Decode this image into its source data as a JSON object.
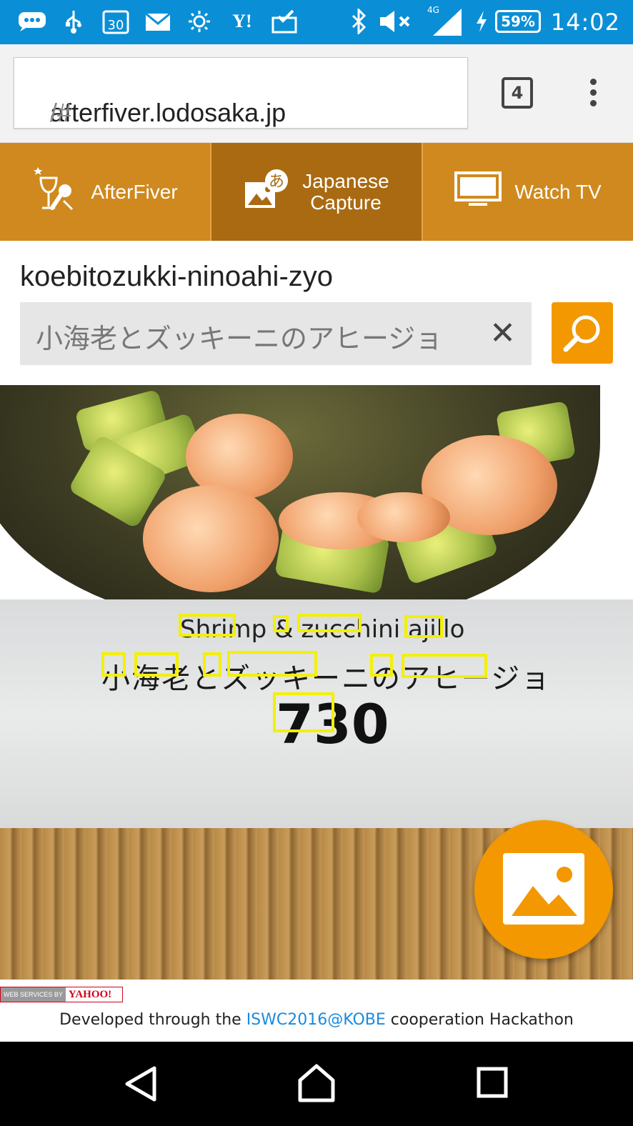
{
  "status_bar": {
    "time": "14:02",
    "battery_percent": "59%",
    "network_type": "4G",
    "date_icon_label": "30",
    "icons": [
      "chat-icon",
      "usb-icon",
      "calendar-icon",
      "mail-icon",
      "brightness-icon",
      "yahoo-icon",
      "mail-check-icon",
      "bluetooth-icon",
      "mute-icon",
      "signal-icon",
      "charging-icon"
    ]
  },
  "browser": {
    "url_host": "afterfiver.lodosaka.jp",
    "url_path": "/#",
    "tab_count": "4"
  },
  "nav": {
    "items": [
      {
        "label": "AfterFiver",
        "icon": "wine-mic-icon"
      },
      {
        "label_line1": "Japanese",
        "label_line2": "Capture",
        "icon": "image-translate-icon",
        "active": true
      },
      {
        "label": "Watch TV",
        "icon": "tv-icon"
      }
    ]
  },
  "search": {
    "page_title": "koebitozukki-ninoahi-zyo",
    "query": "小海老とズッキーニのアヒージョ",
    "clear_glyph": "✕"
  },
  "photo": {
    "menu_english": "Shrimp & zucchini ajillo",
    "menu_japanese": "小海老とズッキーニのアヒージョ",
    "menu_price": "730"
  },
  "footer": {
    "badge_left": "WEB SERVICES BY",
    "badge_right": "YAHOO!",
    "dev_prefix": "Developed through the ",
    "dev_link": "ISWC2016@KOBE",
    "dev_suffix": " cooperation Hackathon"
  },
  "colors": {
    "status_bar": "#0a8fd6",
    "nav_bg": "#d0891e",
    "nav_active": "#a96a12",
    "accent_orange": "#f39800",
    "highlight_box": "#f3f000",
    "link": "#1a8be0"
  }
}
